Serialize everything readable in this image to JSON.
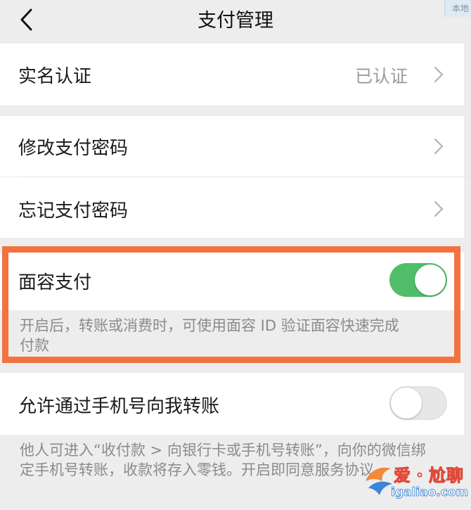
{
  "header": {
    "title": "支付管理",
    "corner_tag": "本地"
  },
  "real_name": {
    "label": "实名认证",
    "value": "已认证"
  },
  "change_password": {
    "label": "修改支付密码"
  },
  "forgot_password": {
    "label": "忘记支付密码"
  },
  "face_pay": {
    "label": "面容支付",
    "enabled": true,
    "hint": "开启后，转账或消费时，可使用面容 ID 验证面容快速完成付款"
  },
  "phone_transfer": {
    "label": "允许通过手机号向我转账",
    "enabled": false,
    "hint": "他人可进入“收付款 > 向银行卡或手机号转账”，向你的微信绑定手机号转账，收款将存入零钱。开启即同意服务协议。"
  },
  "watermark": {
    "line1": "爱・尬聊",
    "line2": "igaliao.com"
  },
  "colors": {
    "toggle_on": "#4fbd6a",
    "highlight": "#f2733f",
    "background": "#ededed"
  },
  "icons": [
    "back-chevron-icon",
    "chevron-right-icon",
    "toggle-switch"
  ]
}
